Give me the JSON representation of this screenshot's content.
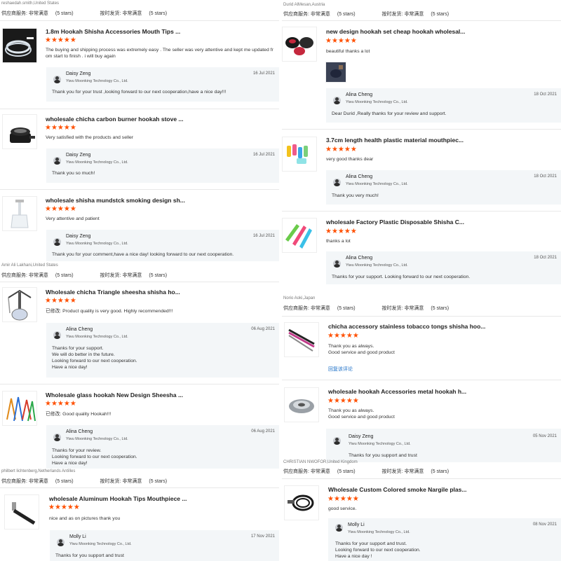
{
  "meta_labels": {
    "supplier": "供应商服务:",
    "shipping": "按时发货:",
    "satisfied": "非常满意",
    "five_stars": "(5 stars)"
  },
  "stars": "★★★★★",
  "colors": {
    "star": "#ff5000",
    "link": "#1a6ec7",
    "reply_bg": "#f3f6f8"
  },
  "left": {
    "buyer1": "reshaedah.smith,United States",
    "reviews": [
      {
        "title": "1.8m Hookah Shisha Accessories Mouth Tips ...",
        "text": [
          "The buying and shipping process was extremely easy . The seller was very attentive and kept me updated fr",
          "om start to finish . i will buy again"
        ],
        "reply_name": "Daisy Zeng",
        "reply_company": "Yiwu Moonking Technology Co., Ltd.",
        "reply_date": "16 Jul 2021",
        "reply_text": [
          "Thank you for your trust ,looking forward to our next cooperation,have a nice day!!!"
        ],
        "thumb_icon": "hose-icon"
      },
      {
        "title": "wholesale chicha carbon burner hookah stove ...",
        "text": [
          "Very satisfied with the products and seller"
        ],
        "reply_name": "Daisy Zeng",
        "reply_company": "Yiwu Moonking Technology Co., Ltd.",
        "reply_date": "16 Jul 2021",
        "reply_text": [
          "Thank you so much!"
        ],
        "thumb_icon": "stove-icon"
      },
      {
        "title": "wholesale shisha mundstck smoking design sh...",
        "text": [
          "Very attentive and patient"
        ],
        "reply_name": "Daisy Zeng",
        "reply_company": "Yiwu Moonking Technology Co., Ltd.",
        "reply_date": "16 Jul 2021",
        "reply_text": [
          "Thank you for your comment,have a nice day! looking forward to our next cooperation."
        ],
        "thumb_icon": "glass-hookah-icon"
      },
      {
        "title": "Wholesale chicha Triangle sheesha shisha ho...",
        "text": [
          "已修改: Product quality is very good. Highly recommended!!!"
        ],
        "reply_name": "Alina Cheng",
        "reply_company": "Yiwu Moonking Technology Co., Ltd.",
        "reply_date": "06 Aug 2021",
        "reply_text": [
          "Thanks for your support.",
          "We will do better in the future.",
          "Looking forward to our next cooperation.",
          "Have a nice day!"
        ],
        "thumb_icon": "hookah-icon"
      },
      {
        "title": "Wholesale glass hookah New Design Sheesha ...",
        "text": [
          "已修改: Good quality Hookah!!!"
        ],
        "reply_name": "Alina Cheng",
        "reply_company": "Yiwu Moonking Technology Co., Ltd.",
        "reply_date": "06 Aug 2021",
        "reply_text": [
          "Thanks for your review.",
          "Looking forward to our next cooperation.",
          "Have a nice day!"
        ],
        "thumb_icon": "hookah-set-icon"
      },
      {
        "title": "wholesale Aluminum Hookah Tips Mouthpiece ...",
        "text": [
          "nice and as on pictures thank you"
        ],
        "reply_name": "Molly Li",
        "reply_company": "Yiwu Moonking Technology Co., Ltd.",
        "reply_date": "17 Nov 2021",
        "reply_text": [
          "Thanks for you support and trust"
        ],
        "thumb_icon": "mouthpiece-icon"
      }
    ],
    "buyer2": "Amir Ali Lakhani,United States",
    "buyer3": "philbert lichtenberg,Netherlands Antilles"
  },
  "right": {
    "buyer1": "Durid AlMesan,Austria",
    "reviews": [
      {
        "title": "new design hookah set cheap hookah wholesal...",
        "text": [
          "beautiful thanks a lot"
        ],
        "reply_name": "Alina Cheng",
        "reply_company": "Yiwu Moonking Technology Co., Ltd.",
        "reply_date": "18 Oct 2021",
        "reply_text": [
          "Dear Durid ,Really thanks for your review and support."
        ],
        "thumb_icon": "bowl-set-icon"
      },
      {
        "title": "3.7cm length health plastic material mouthpiec...",
        "text": [
          "very good thanks dear"
        ],
        "reply_name": "Alina Cheng",
        "reply_company": "Yiwu Moonking Technology Co., Ltd.",
        "reply_date": "18 Oct 2021",
        "reply_text": [
          "Thank you very much!"
        ],
        "thumb_icon": "tips-icon"
      },
      {
        "title": "wholesale Factory Plastic Disposable Shisha C...",
        "text": [
          "thanks a lot"
        ],
        "reply_name": "Alina Cheng",
        "reply_company": "Yiwu Moonking Technology Co., Ltd.",
        "reply_date": "18 Oct 2021",
        "reply_text": [
          "Thanks for your  support. Looking forward to our next cooperation."
        ],
        "thumb_icon": "disposable-tips-icon"
      },
      {
        "title": "chicha accessory stainless tobacco tongs shisha hoo...",
        "text": [
          "Thank you as always.",
          "Good service and good product"
        ],
        "link": "回复该评论",
        "thumb_icon": "tongs-icon"
      },
      {
        "title": "wholesale hookah Accessories metal hookah h...",
        "text": [
          "Thank you as always.",
          "Good service and good product"
        ],
        "reply_name": "Daisy Zeng",
        "reply_company": "Yiwu Moonking Technology Co., Ltd.",
        "reply_date": "05 Nov 2021",
        "reply_text": [
          "Thanks for you support and trust"
        ],
        "thumb_icon": "metal-bowl-icon"
      },
      {
        "title": "Wholesale Custom Colored smoke Nargile plas...",
        "text": [
          "good service."
        ],
        "reply_name": "Molly Li",
        "reply_company": "Yiwu Moonking Technology Co., Ltd.",
        "reply_date": "08 Nov 2021",
        "reply_text": [
          "Thanks for your support and trust.",
          "Looking forward to our next cooperation.",
          "Have a nice day !"
        ],
        "thumb_icon": "hose-coil-icon"
      }
    ],
    "buyer2": "Norio Aoki,Japan",
    "buyer3": "CHRISTIAN NWOFOR,United Kingdom"
  }
}
